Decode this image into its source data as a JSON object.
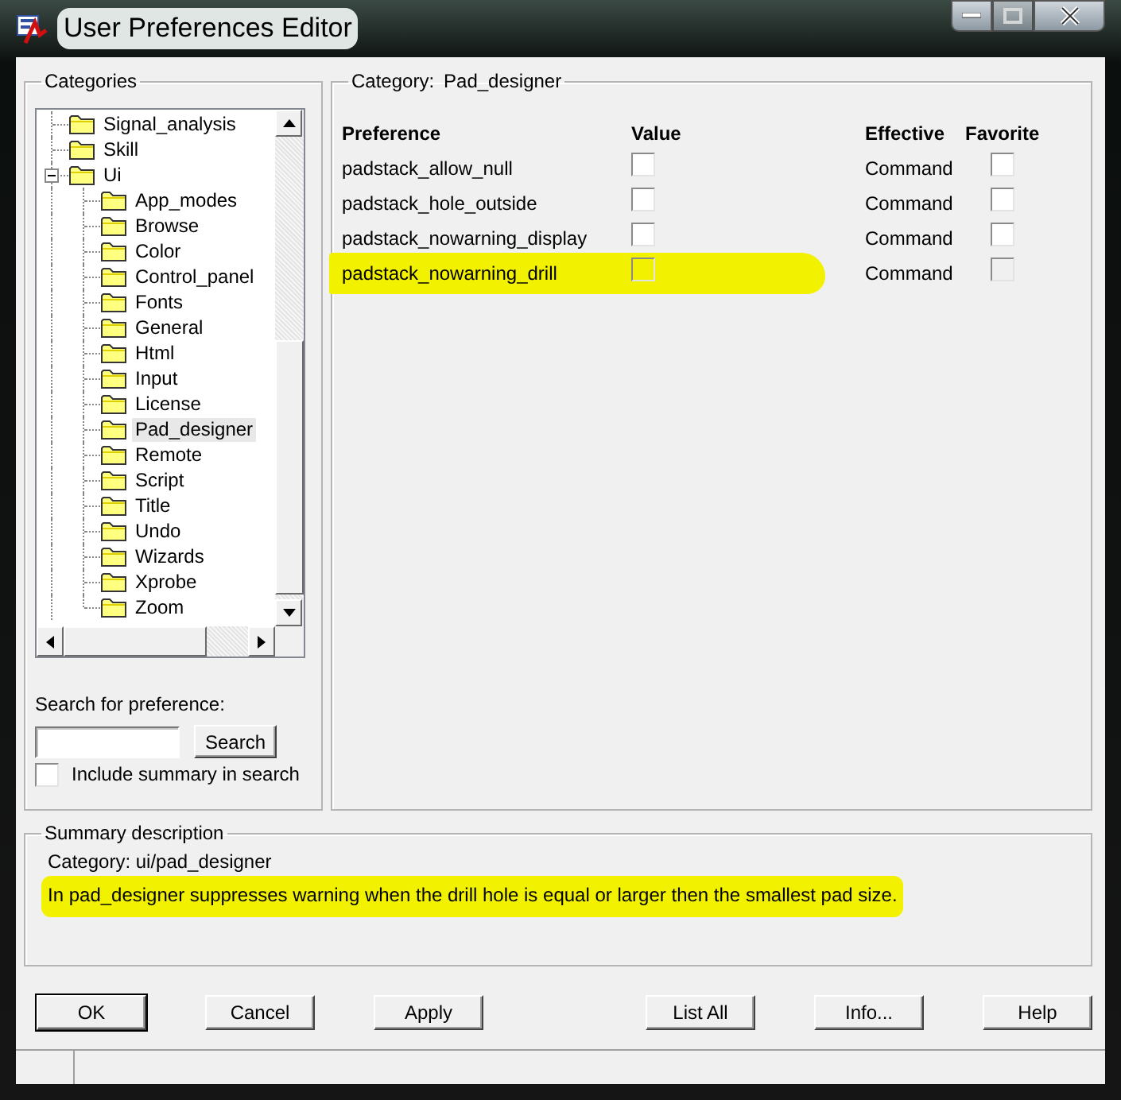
{
  "window": {
    "title": "User Preferences Editor"
  },
  "categories": {
    "label": "Categories",
    "tree": [
      {
        "label": "Signal_analysis",
        "selected": false
      },
      {
        "label": "Skill",
        "selected": false
      },
      {
        "label": "Ui",
        "selected": false,
        "expanded": true,
        "children": [
          {
            "label": "App_modes",
            "selected": false
          },
          {
            "label": "Browse",
            "selected": false
          },
          {
            "label": "Color",
            "selected": false
          },
          {
            "label": "Control_panel",
            "selected": false
          },
          {
            "label": "Fonts",
            "selected": false
          },
          {
            "label": "General",
            "selected": false
          },
          {
            "label": "Html",
            "selected": false
          },
          {
            "label": "Input",
            "selected": false
          },
          {
            "label": "License",
            "selected": false
          },
          {
            "label": "Pad_designer",
            "selected": true
          },
          {
            "label": "Remote",
            "selected": false
          },
          {
            "label": "Script",
            "selected": false
          },
          {
            "label": "Title",
            "selected": false
          },
          {
            "label": "Undo",
            "selected": false
          },
          {
            "label": "Wizards",
            "selected": false
          },
          {
            "label": "Xprobe",
            "selected": false
          },
          {
            "label": "Zoom",
            "selected": false
          }
        ]
      }
    ]
  },
  "search": {
    "label": "Search for preference:",
    "button": "Search",
    "include_summary": {
      "label": "Include summary in search",
      "checked": false
    }
  },
  "preferences": {
    "legend_label": "Category:",
    "legend_value": "Pad_designer",
    "columns": [
      "Preference",
      "Value",
      "Effective",
      "Favorite"
    ],
    "rows": [
      {
        "name": "padstack_allow_null",
        "value_checked": false,
        "effective": "Command",
        "favorite": false,
        "highlighted": false
      },
      {
        "name": "padstack_hole_outside",
        "value_checked": false,
        "effective": "Command",
        "favorite": false,
        "highlighted": false
      },
      {
        "name": "padstack_nowarning_display",
        "value_checked": false,
        "effective": "Command",
        "favorite": false,
        "highlighted": false
      },
      {
        "name": "padstack_nowarning_drill",
        "value_checked": false,
        "effective": "Command",
        "favorite": false,
        "highlighted": true
      }
    ]
  },
  "summary": {
    "label": "Summary description",
    "category": "Category: ui/pad_designer",
    "text": "In pad_designer suppresses warning when the drill hole is equal or larger then the smallest pad size.",
    "highlighted": true
  },
  "buttons": [
    {
      "label": "OK",
      "default": true
    },
    {
      "label": "Cancel",
      "default": false
    },
    {
      "label": "Apply",
      "default": false
    },
    {
      "label": "List All",
      "default": false
    },
    {
      "label": "Info...",
      "default": false
    },
    {
      "label": "Help",
      "default": false
    }
  ]
}
